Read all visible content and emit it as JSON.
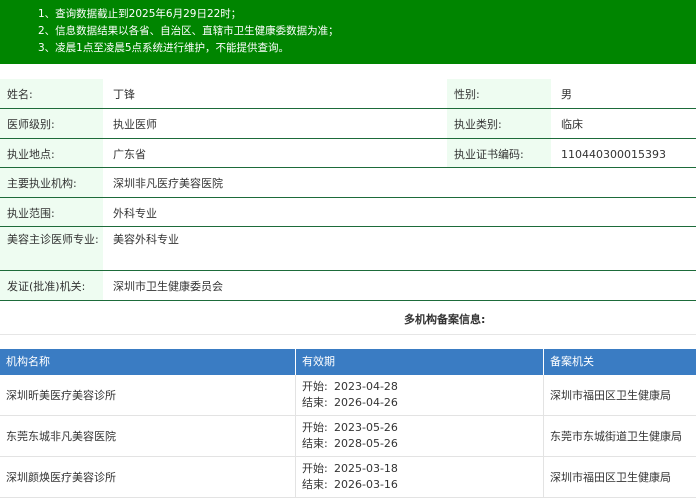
{
  "notice": {
    "lines": [
      "1、查询数据截止到2025年6月29日22时；",
      "2、信息数据结果以各省、自治区、直辖市卫生健康委数据为准；",
      "3、凌晨1点至凌晨5点系统进行维护，不能提供查询。"
    ]
  },
  "info": {
    "name_label": "姓名:",
    "name": "丁锋",
    "gender_label": "性别:",
    "gender": "男",
    "level_label": "医师级别:",
    "level": "执业医师",
    "category_label": "执业类别:",
    "category": "临床",
    "location_label": "执业地点:",
    "location": "广东省",
    "cert_label": "执业证书编码:",
    "cert": "110440300015393",
    "institution_label": "主要执业机构:",
    "institution": "深圳非凡医疗美容医院",
    "scope_label": "执业范围:",
    "scope": "外科专业",
    "beauty_label": "美容主诊医师专业:",
    "beauty": "美容外科专业",
    "issuer_label": "发证(批准)机关:",
    "issuer": "深圳市卫生健康委员会"
  },
  "multi": {
    "title": "多机构备案信息:",
    "headers": [
      "机构名称",
      "有效期",
      "备案机关"
    ],
    "start_label": "开始:",
    "end_label": "结束:",
    "rows": [
      {
        "name": "深圳昕美医疗美容诊所",
        "start": "2023-04-28",
        "end": "2026-04-26",
        "agency": "深圳市福田区卫生健康局"
      },
      {
        "name": "东莞东城非凡美容医院",
        "start": "2023-05-26",
        "end": "2028-05-26",
        "agency": "东莞市东城街道卫生健康局"
      },
      {
        "name": "深圳颜焕医疗美容诊所",
        "start": "2025-03-18",
        "end": "2026-03-16",
        "agency": "深圳市福田区卫生健康局"
      }
    ]
  }
}
